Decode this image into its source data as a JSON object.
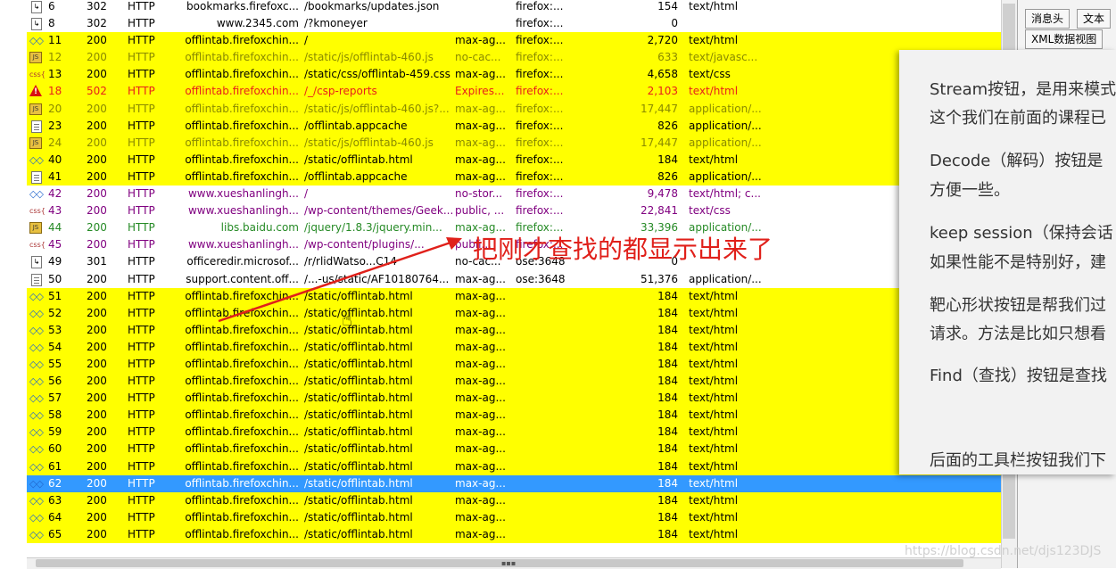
{
  "rows": [
    {
      "num": "6",
      "result": "302",
      "protocol": "HTTP",
      "host": "bookmarks.firefoxc...",
      "url": "/bookmarks/updates.json",
      "caching": "",
      "ctype": "firefox:...",
      "body": "154",
      "content_type": "text/html",
      "icon": "redirect-icon",
      "style": "normal"
    },
    {
      "num": "8",
      "result": "302",
      "protocol": "HTTP",
      "host": "www.2345.com",
      "url": "/?kmoneyer",
      "caching": "",
      "ctype": "firefox:...",
      "body": "0",
      "content_type": "",
      "icon": "redirect-icon",
      "style": "normal"
    },
    {
      "num": "11",
      "result": "200",
      "protocol": "HTTP",
      "host": "offlintab.firefoxchin...",
      "url": "/",
      "caching": "max-ag...",
      "ctype": "firefox:...",
      "body": "2,720",
      "content_type": "text/html",
      "icon": "html-icon",
      "style": "hl"
    },
    {
      "num": "12",
      "result": "200",
      "protocol": "HTTP",
      "host": "offlintab.firefoxchin...",
      "url": "/static/js/offlintab-460.js",
      "caching": "no-cac...",
      "ctype": "firefox:...",
      "body": "633",
      "content_type": "text/javasc...",
      "icon": "js-icon",
      "style": "hl yellowtext"
    },
    {
      "num": "13",
      "result": "200",
      "protocol": "HTTP",
      "host": "offlintab.firefoxchin...",
      "url": "/static/css/offlintab-459.css",
      "caching": "max-ag...",
      "ctype": "firefox:...",
      "body": "4,658",
      "content_type": "text/css",
      "icon": "css-icon",
      "style": "hl"
    },
    {
      "num": "18",
      "result": "502",
      "protocol": "HTTP",
      "host": "offlintab.firefoxchin...",
      "url": "/_/csp-reports",
      "caching": "Expires...",
      "ctype": "firefox:...",
      "body": "2,103",
      "content_type": "text/html",
      "icon": "warning-icon",
      "style": "hl red"
    },
    {
      "num": "20",
      "result": "200",
      "protocol": "HTTP",
      "host": "offlintab.firefoxchin...",
      "url": "/static/js/offlintab-460.js?...",
      "caching": "max-ag...",
      "ctype": "firefox:...",
      "body": "17,447",
      "content_type": "application/...",
      "icon": "js-icon",
      "style": "hl yellowtext"
    },
    {
      "num": "23",
      "result": "200",
      "protocol": "HTTP",
      "host": "offlintab.firefoxchin...",
      "url": "/offlintab.appcache",
      "caching": "max-ag...",
      "ctype": "firefox:...",
      "body": "826",
      "content_type": "application/...",
      "icon": "document-icon",
      "style": "hl"
    },
    {
      "num": "24",
      "result": "200",
      "protocol": "HTTP",
      "host": "offlintab.firefoxchin...",
      "url": "/static/js/offlintab-460.js",
      "caching": "max-ag...",
      "ctype": "firefox:...",
      "body": "17,447",
      "content_type": "application/...",
      "icon": "js-icon",
      "style": "hl yellowtext"
    },
    {
      "num": "40",
      "result": "200",
      "protocol": "HTTP",
      "host": "offlintab.firefoxchin...",
      "url": "/static/offlintab.html",
      "caching": "max-ag...",
      "ctype": "firefox:...",
      "body": "184",
      "content_type": "text/html",
      "icon": "html-icon",
      "style": "hl"
    },
    {
      "num": "41",
      "result": "200",
      "protocol": "HTTP",
      "host": "offlintab.firefoxchin...",
      "url": "/offlintab.appcache",
      "caching": "max-ag...",
      "ctype": "firefox:...",
      "body": "826",
      "content_type": "application/...",
      "icon": "document-icon",
      "style": "hl"
    },
    {
      "num": "42",
      "result": "200",
      "protocol": "HTTP",
      "host": "www.xueshanlingh...",
      "url": "/",
      "caching": "no-stor...",
      "ctype": "firefox:...",
      "body": "9,478",
      "content_type": "text/html; c...",
      "icon": "html-icon",
      "style": "purple"
    },
    {
      "num": "43",
      "result": "200",
      "protocol": "HTTP",
      "host": "www.xueshanlingh...",
      "url": "/wp-content/themes/Geek...",
      "caching": "public, ...",
      "ctype": "firefox:...",
      "body": "22,841",
      "content_type": "text/css",
      "icon": "css-icon",
      "style": "purple"
    },
    {
      "num": "44",
      "result": "200",
      "protocol": "HTTP",
      "host": "libs.baidu.com",
      "url": "/jquery/1.8.3/jquery.min...",
      "caching": "max-ag...",
      "ctype": "firefox:...",
      "body": "33,396",
      "content_type": "application/...",
      "icon": "js-icon",
      "style": "green"
    },
    {
      "num": "45",
      "result": "200",
      "protocol": "HTTP",
      "host": "www.xueshanlingh...",
      "url": "/wp-content/plugins/...",
      "caching": "publi...",
      "ctype": "firefox:...",
      "body": "",
      "content_type": "",
      "icon": "css-icon",
      "style": "purple"
    },
    {
      "num": "49",
      "result": "301",
      "protocol": "HTTP",
      "host": "officeredir.microsof...",
      "url": "/r/rlidWatso...C14",
      "caching": "no-cac...",
      "ctype": "ose:3648",
      "body": "0",
      "content_type": "",
      "icon": "redirect-icon",
      "style": "normal"
    },
    {
      "num": "50",
      "result": "200",
      "protocol": "HTTP",
      "host": "support.content.off...",
      "url": "/...-us/static/AF10180764...",
      "caching": "max-ag...",
      "ctype": "ose:3648",
      "body": "51,376",
      "content_type": "application/...",
      "icon": "document-icon",
      "style": "normal"
    },
    {
      "num": "51",
      "result": "200",
      "protocol": "HTTP",
      "host": "offlintab.firefoxchin...",
      "url": "/static/offlintab.html",
      "caching": "max-ag...",
      "ctype": "",
      "body": "184",
      "content_type": "text/html",
      "icon": "html-icon",
      "style": "hl"
    },
    {
      "num": "52",
      "result": "200",
      "protocol": "HTTP",
      "host": "offlintab.firefoxchin...",
      "url": "/static/offlintab.html",
      "caching": "max-ag...",
      "ctype": "",
      "body": "184",
      "content_type": "text/html",
      "icon": "html-icon",
      "style": "hl"
    },
    {
      "num": "53",
      "result": "200",
      "protocol": "HTTP",
      "host": "offlintab.firefoxchin...",
      "url": "/static/offlintab.html",
      "caching": "max-ag...",
      "ctype": "",
      "body": "184",
      "content_type": "text/html",
      "icon": "html-icon",
      "style": "hl"
    },
    {
      "num": "54",
      "result": "200",
      "protocol": "HTTP",
      "host": "offlintab.firefoxchin...",
      "url": "/static/offlintab.html",
      "caching": "max-ag...",
      "ctype": "",
      "body": "184",
      "content_type": "text/html",
      "icon": "html-icon",
      "style": "hl"
    },
    {
      "num": "55",
      "result": "200",
      "protocol": "HTTP",
      "host": "offlintab.firefoxchin...",
      "url": "/static/offlintab.html",
      "caching": "max-ag...",
      "ctype": "",
      "body": "184",
      "content_type": "text/html",
      "icon": "html-icon",
      "style": "hl"
    },
    {
      "num": "56",
      "result": "200",
      "protocol": "HTTP",
      "host": "offlintab.firefoxchin...",
      "url": "/static/offlintab.html",
      "caching": "max-ag...",
      "ctype": "",
      "body": "184",
      "content_type": "text/html",
      "icon": "html-icon",
      "style": "hl"
    },
    {
      "num": "57",
      "result": "200",
      "protocol": "HTTP",
      "host": "offlintab.firefoxchin...",
      "url": "/static/offlintab.html",
      "caching": "max-ag...",
      "ctype": "",
      "body": "184",
      "content_type": "text/html",
      "icon": "html-icon",
      "style": "hl"
    },
    {
      "num": "58",
      "result": "200",
      "protocol": "HTTP",
      "host": "offlintab.firefoxchin...",
      "url": "/static/offlintab.html",
      "caching": "max-ag...",
      "ctype": "",
      "body": "184",
      "content_type": "text/html",
      "icon": "html-icon",
      "style": "hl"
    },
    {
      "num": "59",
      "result": "200",
      "protocol": "HTTP",
      "host": "offlintab.firefoxchin...",
      "url": "/static/offlintab.html",
      "caching": "max-ag...",
      "ctype": "",
      "body": "184",
      "content_type": "text/html",
      "icon": "html-icon",
      "style": "hl"
    },
    {
      "num": "60",
      "result": "200",
      "protocol": "HTTP",
      "host": "offlintab.firefoxchin...",
      "url": "/static/offlintab.html",
      "caching": "max-ag...",
      "ctype": "",
      "body": "184",
      "content_type": "text/html",
      "icon": "html-icon",
      "style": "hl"
    },
    {
      "num": "61",
      "result": "200",
      "protocol": "HTTP",
      "host": "offlintab.firefoxchin...",
      "url": "/static/offlintab.html",
      "caching": "max-ag...",
      "ctype": "",
      "body": "184",
      "content_type": "text/html",
      "icon": "html-icon",
      "style": "hl"
    },
    {
      "num": "62",
      "result": "200",
      "protocol": "HTTP",
      "host": "offlintab.firefoxchin...",
      "url": "/static/offlintab.html",
      "caching": "max-ag...",
      "ctype": "",
      "body": "184",
      "content_type": "text/html",
      "icon": "html-icon",
      "style": "sel"
    },
    {
      "num": "63",
      "result": "200",
      "protocol": "HTTP",
      "host": "offlintab.firefoxchin...",
      "url": "/static/offlintab.html",
      "caching": "max-ag...",
      "ctype": "",
      "body": "184",
      "content_type": "text/html",
      "icon": "html-icon",
      "style": "hl"
    },
    {
      "num": "64",
      "result": "200",
      "protocol": "HTTP",
      "host": "offlintab.firefoxchin...",
      "url": "/static/offlintab.html",
      "caching": "max-ag...",
      "ctype": "",
      "body": "184",
      "content_type": "text/html",
      "icon": "html-icon",
      "style": "hl"
    },
    {
      "num": "65",
      "result": "200",
      "protocol": "HTTP",
      "host": "offlintab.firefoxchin...",
      "url": "/static/offlintab.html",
      "caching": "max-ag...",
      "ctype": "",
      "body": "184",
      "content_type": "text/html",
      "icon": "html-icon",
      "style": "hl"
    }
  ],
  "inspector": {
    "tab_headers": "消息头",
    "tab_text": "文本",
    "tab_xml": "XML数据视图"
  },
  "slide": {
    "line1": "Stream按钮，是用来模式",
    "line2": "这个我们在前面的课程已",
    "line3": "Decode（解码）按钮是",
    "line4": "方便一些。",
    "line5": "keep session（保持会话",
    "line6": "如果性能不是特别好，建",
    "line7": "靶心形状按钮是帮我们过",
    "line8": "请求。方法是比如只想看",
    "line9": "Find（查找）按钮是查找",
    "line10": "后面的工具栏按钮我们下"
  },
  "annotation": "把刚才查找的都显示出来了",
  "watermark": "https://blog.csdn.net/djs123DJS",
  "colors": {
    "highlight": "#ffff00",
    "selected": "#3399ff",
    "annotation": "#e0201a",
    "error": "#e8201a"
  }
}
